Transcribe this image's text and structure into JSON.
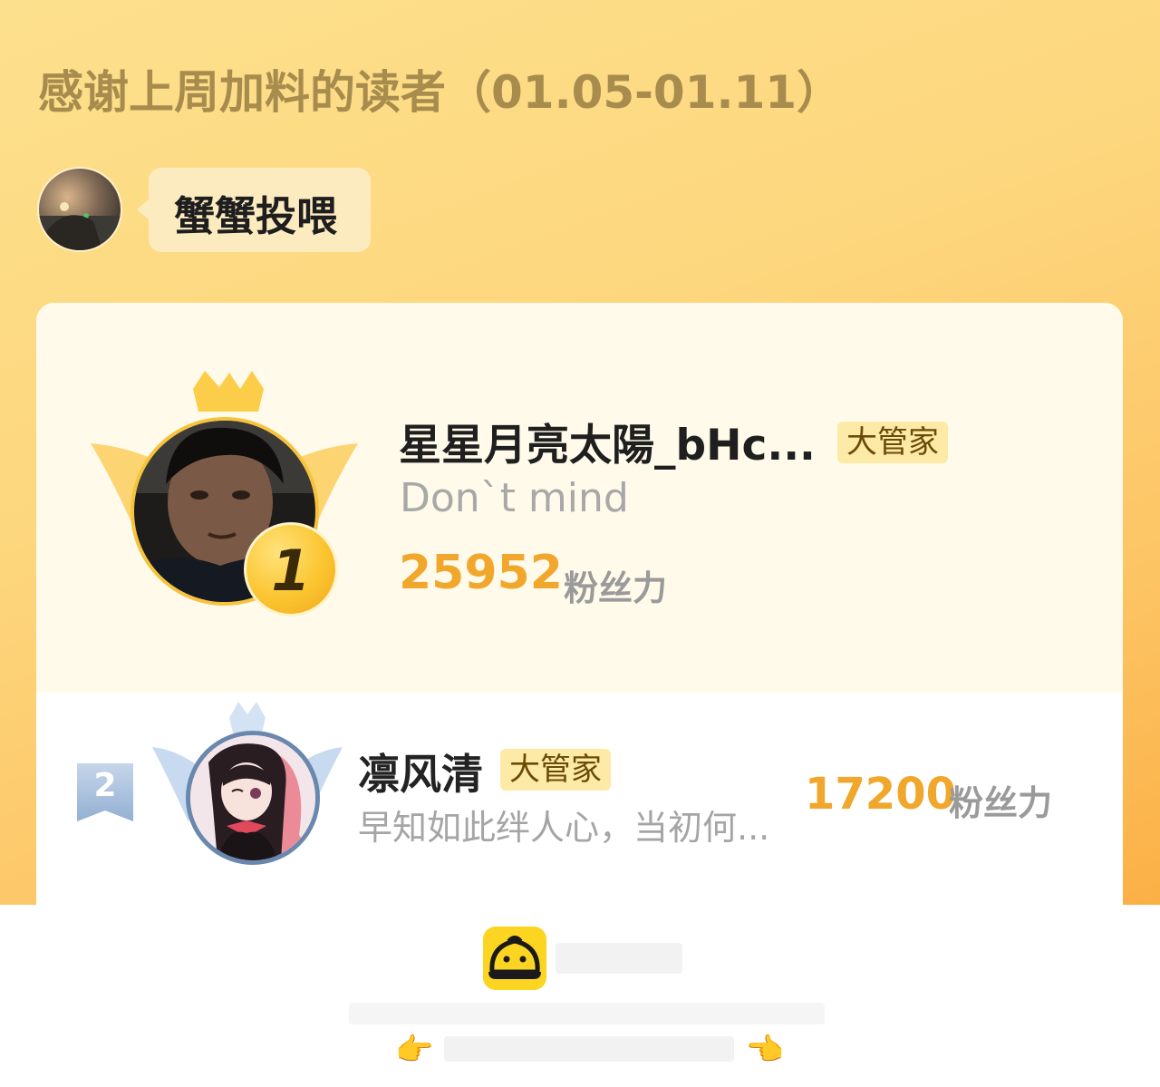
{
  "header": {
    "title": "感谢上周加料的读者（01.05-01.11）"
  },
  "host": {
    "avatar_icon": "user-photo-avatar",
    "bubble_text": "蟹蟹投喂"
  },
  "ranking": [
    {
      "rank": "1",
      "name": "星星月亮太陽_bHc...",
      "tag": "大管家",
      "motto": "Don`t mind",
      "score": "25952",
      "score_unit": "粉丝力",
      "medal_color": "#fbc531"
    },
    {
      "rank": "2",
      "name": "凛风清",
      "tag": "大管家",
      "motto": "早知如此绊人心，当初何...",
      "score": "17200",
      "score_unit": "粉丝力",
      "flag_color": "#9fb8d8"
    }
  ],
  "footer": {
    "app_icon": "steamed-bun-logo-icon",
    "left_pointer_icon": "pointing-right-hand-icon",
    "right_pointer_icon": "pointing-left-hand-icon"
  },
  "colors": {
    "accent": "#f0a72b",
    "title": "#a88c4e",
    "tag_bg": "#fdeaa7"
  }
}
